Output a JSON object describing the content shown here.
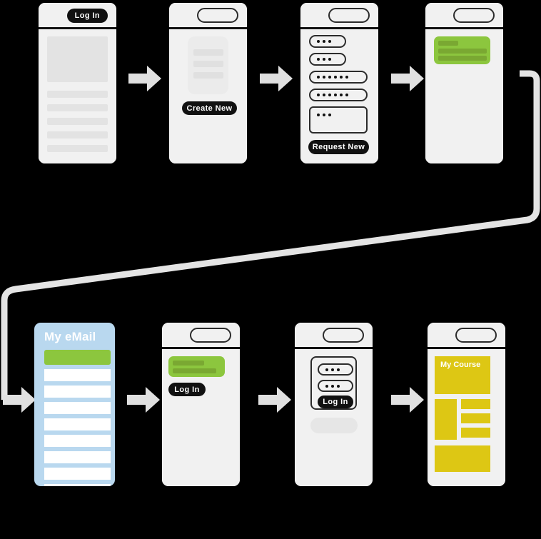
{
  "diagram": {
    "title": "Account request and course access user flow",
    "background_color": "#000000",
    "connector_color": "#e4e4e4",
    "arrow_color": "#e0e0e0",
    "accent_green": "#8cc63e",
    "accent_green_dark": "#7aa832",
    "accent_blue": "#b9d8ef",
    "accent_yellow": "#ddc714",
    "frame_fill": "#f1f1f1",
    "stroke_dark": "#111111"
  },
  "row1": {
    "screens": [
      {
        "id": "screen-landing",
        "name": "landing-screen",
        "header_button": "Log In",
        "blocks": [
          "hero",
          "line",
          "line",
          "line",
          "line",
          "line"
        ]
      },
      {
        "id": "screen-list",
        "name": "list-screen",
        "button": "Create New",
        "card_lines": 3
      },
      {
        "id": "screen-form",
        "name": "request-form-screen",
        "button": "Request New",
        "fields": [
          {
            "name": "field-short-1",
            "dots": 3,
            "type": "input",
            "size": "narrow"
          },
          {
            "name": "field-short-2",
            "dots": 3,
            "type": "input",
            "size": "narrow"
          },
          {
            "name": "field-wide-1",
            "dots": 6,
            "type": "input",
            "size": "wide"
          },
          {
            "name": "field-wide-2",
            "dots": 6,
            "type": "input",
            "size": "wide"
          },
          {
            "name": "field-message",
            "dots": 3,
            "type": "textarea",
            "size": "wide"
          }
        ]
      },
      {
        "id": "screen-confirmation",
        "name": "confirmation-screen",
        "card_lines": 3
      }
    ]
  },
  "row2": {
    "screens": [
      {
        "id": "screen-email",
        "name": "email-inbox-screen",
        "title": "My eMail",
        "highlight_rows": 1,
        "plain_rows": 9
      },
      {
        "id": "screen-email-open",
        "name": "email-message-screen",
        "button": "Log In",
        "card_lines": 2
      },
      {
        "id": "screen-login",
        "name": "login-screen",
        "button": "Log In",
        "fields": [
          {
            "name": "username-field",
            "dots": 3
          },
          {
            "name": "password-field",
            "dots": 3
          }
        ]
      },
      {
        "id": "screen-course",
        "name": "course-dashboard-screen",
        "title": "My Course"
      }
    ]
  },
  "arrows": {
    "row1": [
      {
        "name": "arrow-landing-to-list"
      },
      {
        "name": "arrow-list-to-form"
      },
      {
        "name": "arrow-form-to-confirmation"
      }
    ],
    "row2": [
      {
        "name": "arrow-connector-to-email"
      },
      {
        "name": "arrow-email-to-message"
      },
      {
        "name": "arrow-message-to-login"
      },
      {
        "name": "arrow-login-to-course"
      }
    ]
  },
  "connector": {
    "name": "flow-connector-line",
    "description": "routes from confirmation screen to email inbox screen"
  }
}
